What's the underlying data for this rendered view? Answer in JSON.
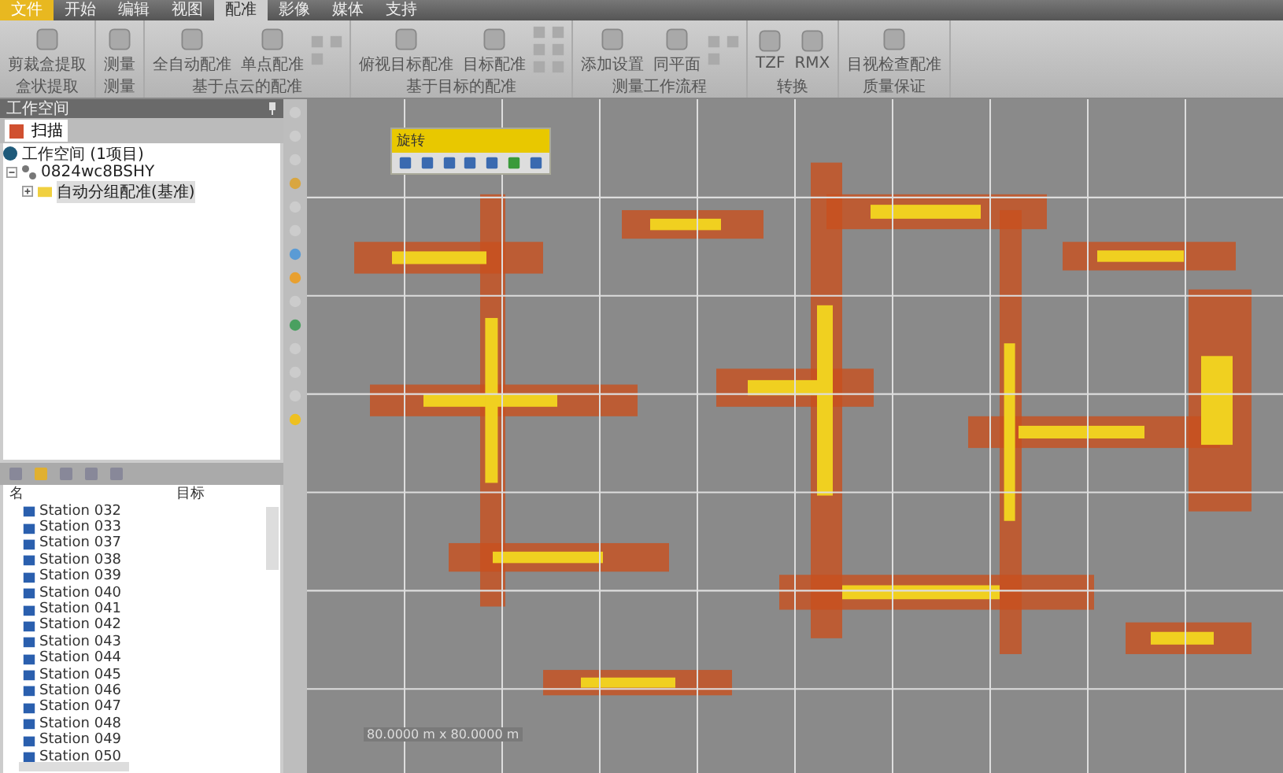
{
  "ribbon": {
    "tabs": [
      {
        "label": "文件",
        "selected": false,
        "kind": "file"
      },
      {
        "label": "开始",
        "selected": false,
        "kind": "tab"
      },
      {
        "label": "编辑",
        "selected": false,
        "kind": "tab"
      },
      {
        "label": "视图",
        "selected": false,
        "kind": "tab"
      },
      {
        "label": "配准",
        "selected": true,
        "kind": "tab"
      },
      {
        "label": "影像",
        "selected": false,
        "kind": "tab"
      },
      {
        "label": "媒体",
        "selected": false,
        "kind": "tab"
      },
      {
        "label": "支持",
        "selected": false,
        "kind": "tab"
      }
    ],
    "groups": [
      {
        "label": "盒状提取",
        "buttons": [
          "剪裁盒提取"
        ]
      },
      {
        "label": "测量",
        "buttons": [
          "测量"
        ]
      },
      {
        "label": "基于点云的配准",
        "buttons": [
          "全自动配准",
          "单点配准"
        ]
      },
      {
        "label": "基于目标的配准",
        "buttons": [
          "俯视目标配准",
          "目标配准"
        ]
      },
      {
        "label": "测量工作流程",
        "buttons": [
          "添加设置",
          "同平面"
        ]
      },
      {
        "label": "转换",
        "buttons": [
          "TZF",
          "RMX"
        ]
      },
      {
        "label": "质量保证",
        "buttons": [
          "目视检查配准"
        ]
      }
    ]
  },
  "workspace": {
    "title": "工作空间",
    "tab": "扫描",
    "root": "工作空间 (1项目)",
    "tree": [
      {
        "label": "0824wc8BSHY",
        "expanded": true,
        "selected": false,
        "children": [
          {
            "label": "自动分组配准(基准)",
            "expanded": false,
            "selected": true
          }
        ]
      }
    ]
  },
  "list": {
    "columns": [
      "名",
      "目标"
    ],
    "rows": [
      "Station 032",
      "Station 033",
      "Station 037",
      "Station 038",
      "Station 039",
      "Station 040",
      "Station 041",
      "Station 042",
      "Station 043",
      "Station 044",
      "Station 045",
      "Station 046",
      "Station 047",
      "Station 048",
      "Station 049",
      "Station 050"
    ]
  },
  "floating_toolbar": {
    "title": "旋转"
  },
  "viewport": {
    "scale": "80.0000 m x 80.0000 m"
  }
}
